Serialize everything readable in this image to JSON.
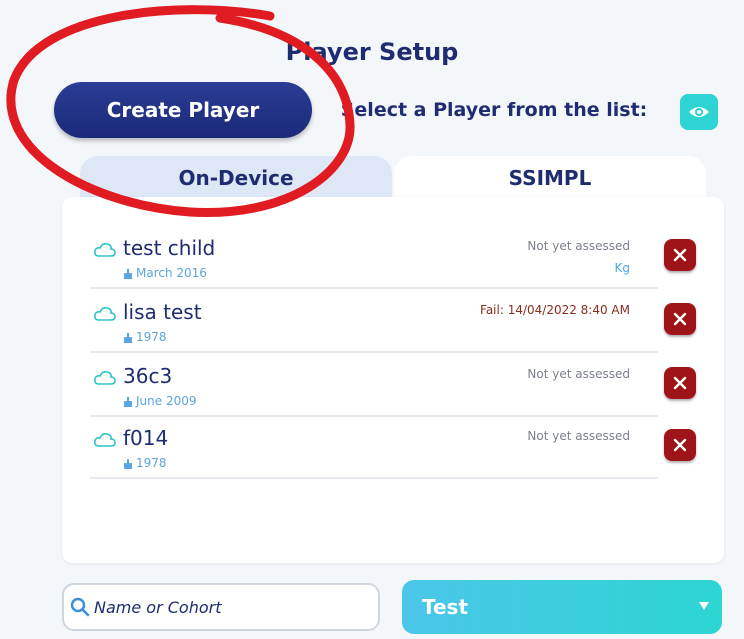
{
  "header": {
    "title": "Player Setup"
  },
  "actions": {
    "create_label": "Create Player",
    "select_prompt": "Select a Player from the list:"
  },
  "tabs": [
    {
      "label": "On-Device",
      "selected": false
    },
    {
      "label": "SSIMPL",
      "selected": true
    }
  ],
  "players": [
    {
      "name": "test child",
      "dob": "March 2016",
      "status": "Not yet assessed",
      "unit": "Kg",
      "status_type": "pending"
    },
    {
      "name": "lisa test",
      "dob": "1978",
      "status": "Fail: 14/04/2022 8:40 AM",
      "unit": "",
      "status_type": "fail"
    },
    {
      "name": "36c3",
      "dob": "June 2009",
      "status": "Not yet assessed",
      "unit": "",
      "status_type": "pending"
    },
    {
      "name": "f014",
      "dob": "1978",
      "status": "Not yet assessed",
      "unit": "",
      "status_type": "pending"
    }
  ],
  "search": {
    "placeholder": "Name or Cohort",
    "value": ""
  },
  "dropdown": {
    "selected": "Test"
  },
  "icons": {
    "eye": "eye-icon",
    "cloud": "cloud-icon",
    "cake": "cake-icon",
    "delete": "close-icon",
    "search": "search-icon",
    "caret": "caret-down-icon"
  },
  "colors": {
    "primary": "#1e2c72",
    "accent": "#2ed3d3",
    "danger": "#9e1418",
    "annotation": "#e01b22"
  }
}
